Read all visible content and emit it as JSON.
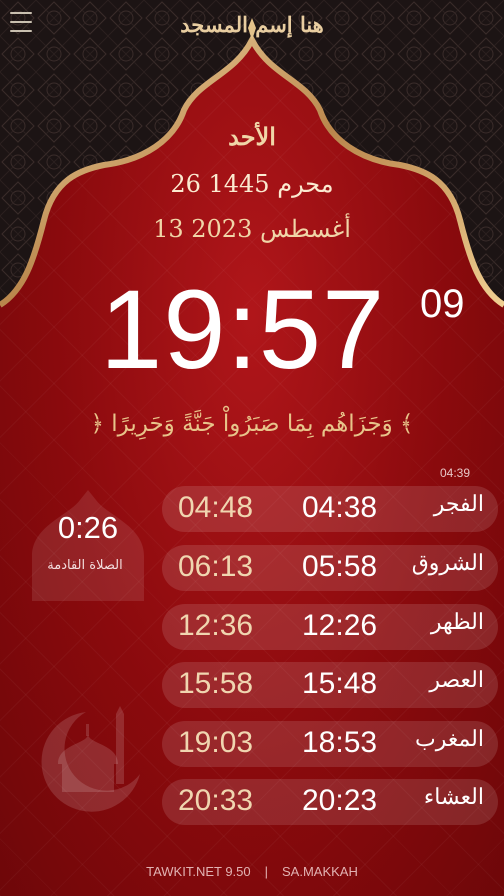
{
  "header": {
    "mosque_name": "هنا إسم المسجد",
    "menu_icon": "menu-icon"
  },
  "date": {
    "day": "الأحد",
    "hijri": "26 محرم 1445",
    "gregorian": "13 أغسطس 2023"
  },
  "clock": {
    "time": "19:57",
    "seconds": "09"
  },
  "verse": "﴿ وَجَزَاهُم بِمَا صَبَرُواْ جَنَّةً وَحَرِيرًا ﴾",
  "small_time": "04:39",
  "next_prayer": {
    "countdown": "0:26",
    "label": "الصلاة القادمة"
  },
  "prayers": [
    {
      "name": "الفجر",
      "adhan": "04:38",
      "iqama": "04:48"
    },
    {
      "name": "الشروق",
      "adhan": "05:58",
      "iqama": "06:13"
    },
    {
      "name": "الظهر",
      "adhan": "12:26",
      "iqama": "12:36"
    },
    {
      "name": "العصر",
      "adhan": "15:48",
      "iqama": "15:58"
    },
    {
      "name": "المغرب",
      "adhan": "18:53",
      "iqama": "19:03"
    },
    {
      "name": "العشاء",
      "adhan": "20:23",
      "iqama": "20:33"
    }
  ],
  "footer": {
    "version": "TAWKIT.NET 9.50",
    "separator": "|",
    "location": "SA.MAKKAH"
  },
  "colors": {
    "background": "#8e0b0e",
    "gold": "#e8cda0",
    "dark_top": "#1c1414"
  }
}
